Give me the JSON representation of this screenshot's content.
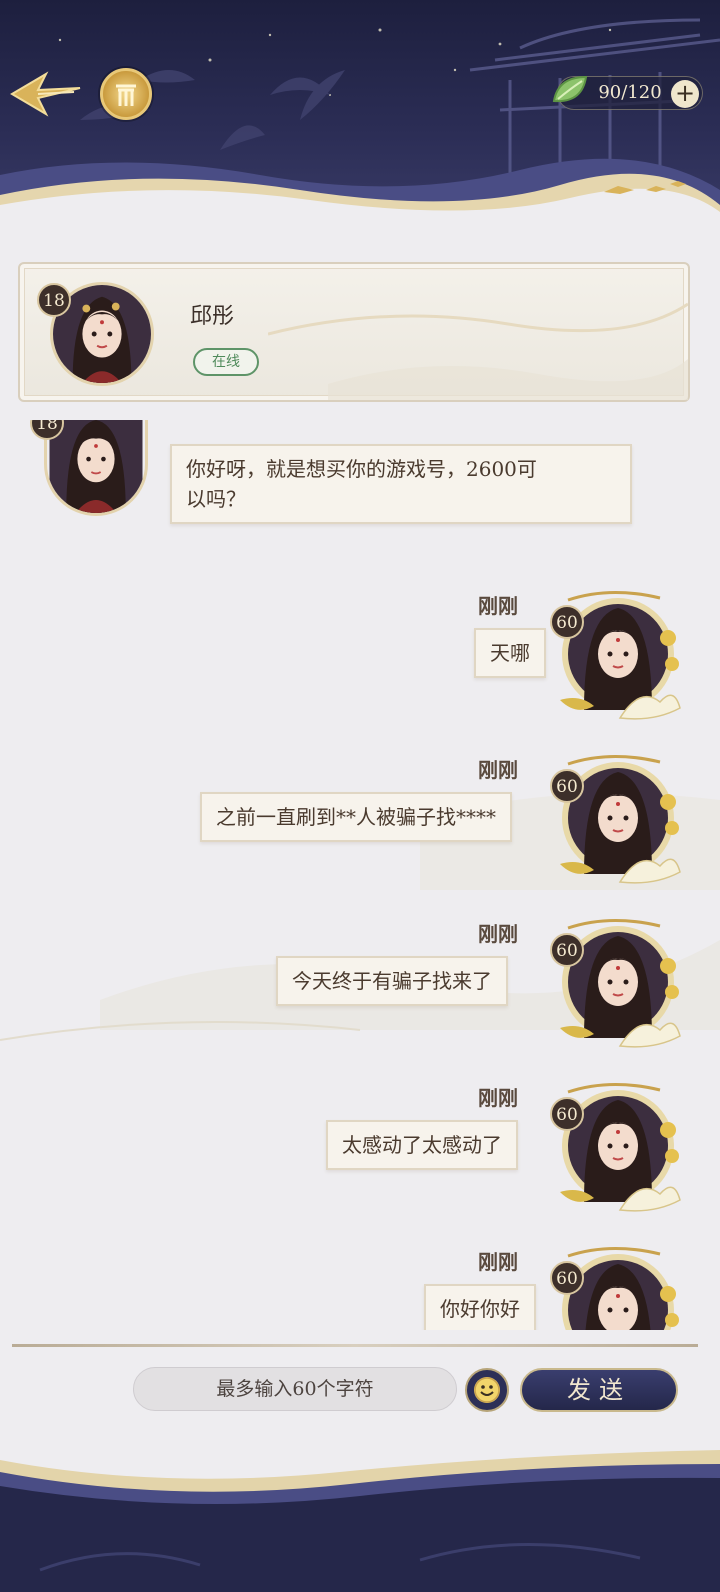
{
  "header": {
    "back_icon": "back-arrow-icon",
    "home_icon": "home-gate-icon",
    "stamina": "90/120",
    "stamina_plus": "+",
    "stamina_icon": "leaf-icon"
  },
  "profile": {
    "level": "18",
    "name": "邱彤",
    "status": "在线"
  },
  "messages": [
    {
      "side": "left",
      "level": "18",
      "text_line1": "你好呀，就是想买你的游戏号，2600可",
      "text_line2": "以吗？"
    },
    {
      "side": "right",
      "level": "60",
      "time": "刚刚",
      "text": "天哪"
    },
    {
      "side": "right",
      "level": "60",
      "time": "刚刚",
      "text": "之前一直刷到**人被骗子找****"
    },
    {
      "side": "right",
      "level": "60",
      "time": "刚刚",
      "text": "今天终于有骗子找来了"
    },
    {
      "side": "right",
      "level": "60",
      "time": "刚刚",
      "text": "太感动了太感动了"
    },
    {
      "side": "right",
      "level": "60",
      "time": "刚刚",
      "text": "你好你好"
    }
  ],
  "input": {
    "placeholder": "最多输入60个字符",
    "emoji_icon": "smiley-icon",
    "send_label": "发送"
  },
  "colors": {
    "banner": "#2b2d55",
    "gold": "#c9a24d",
    "bubble_bg": "#f7f3ec",
    "online_green": "#4f8a5b"
  }
}
